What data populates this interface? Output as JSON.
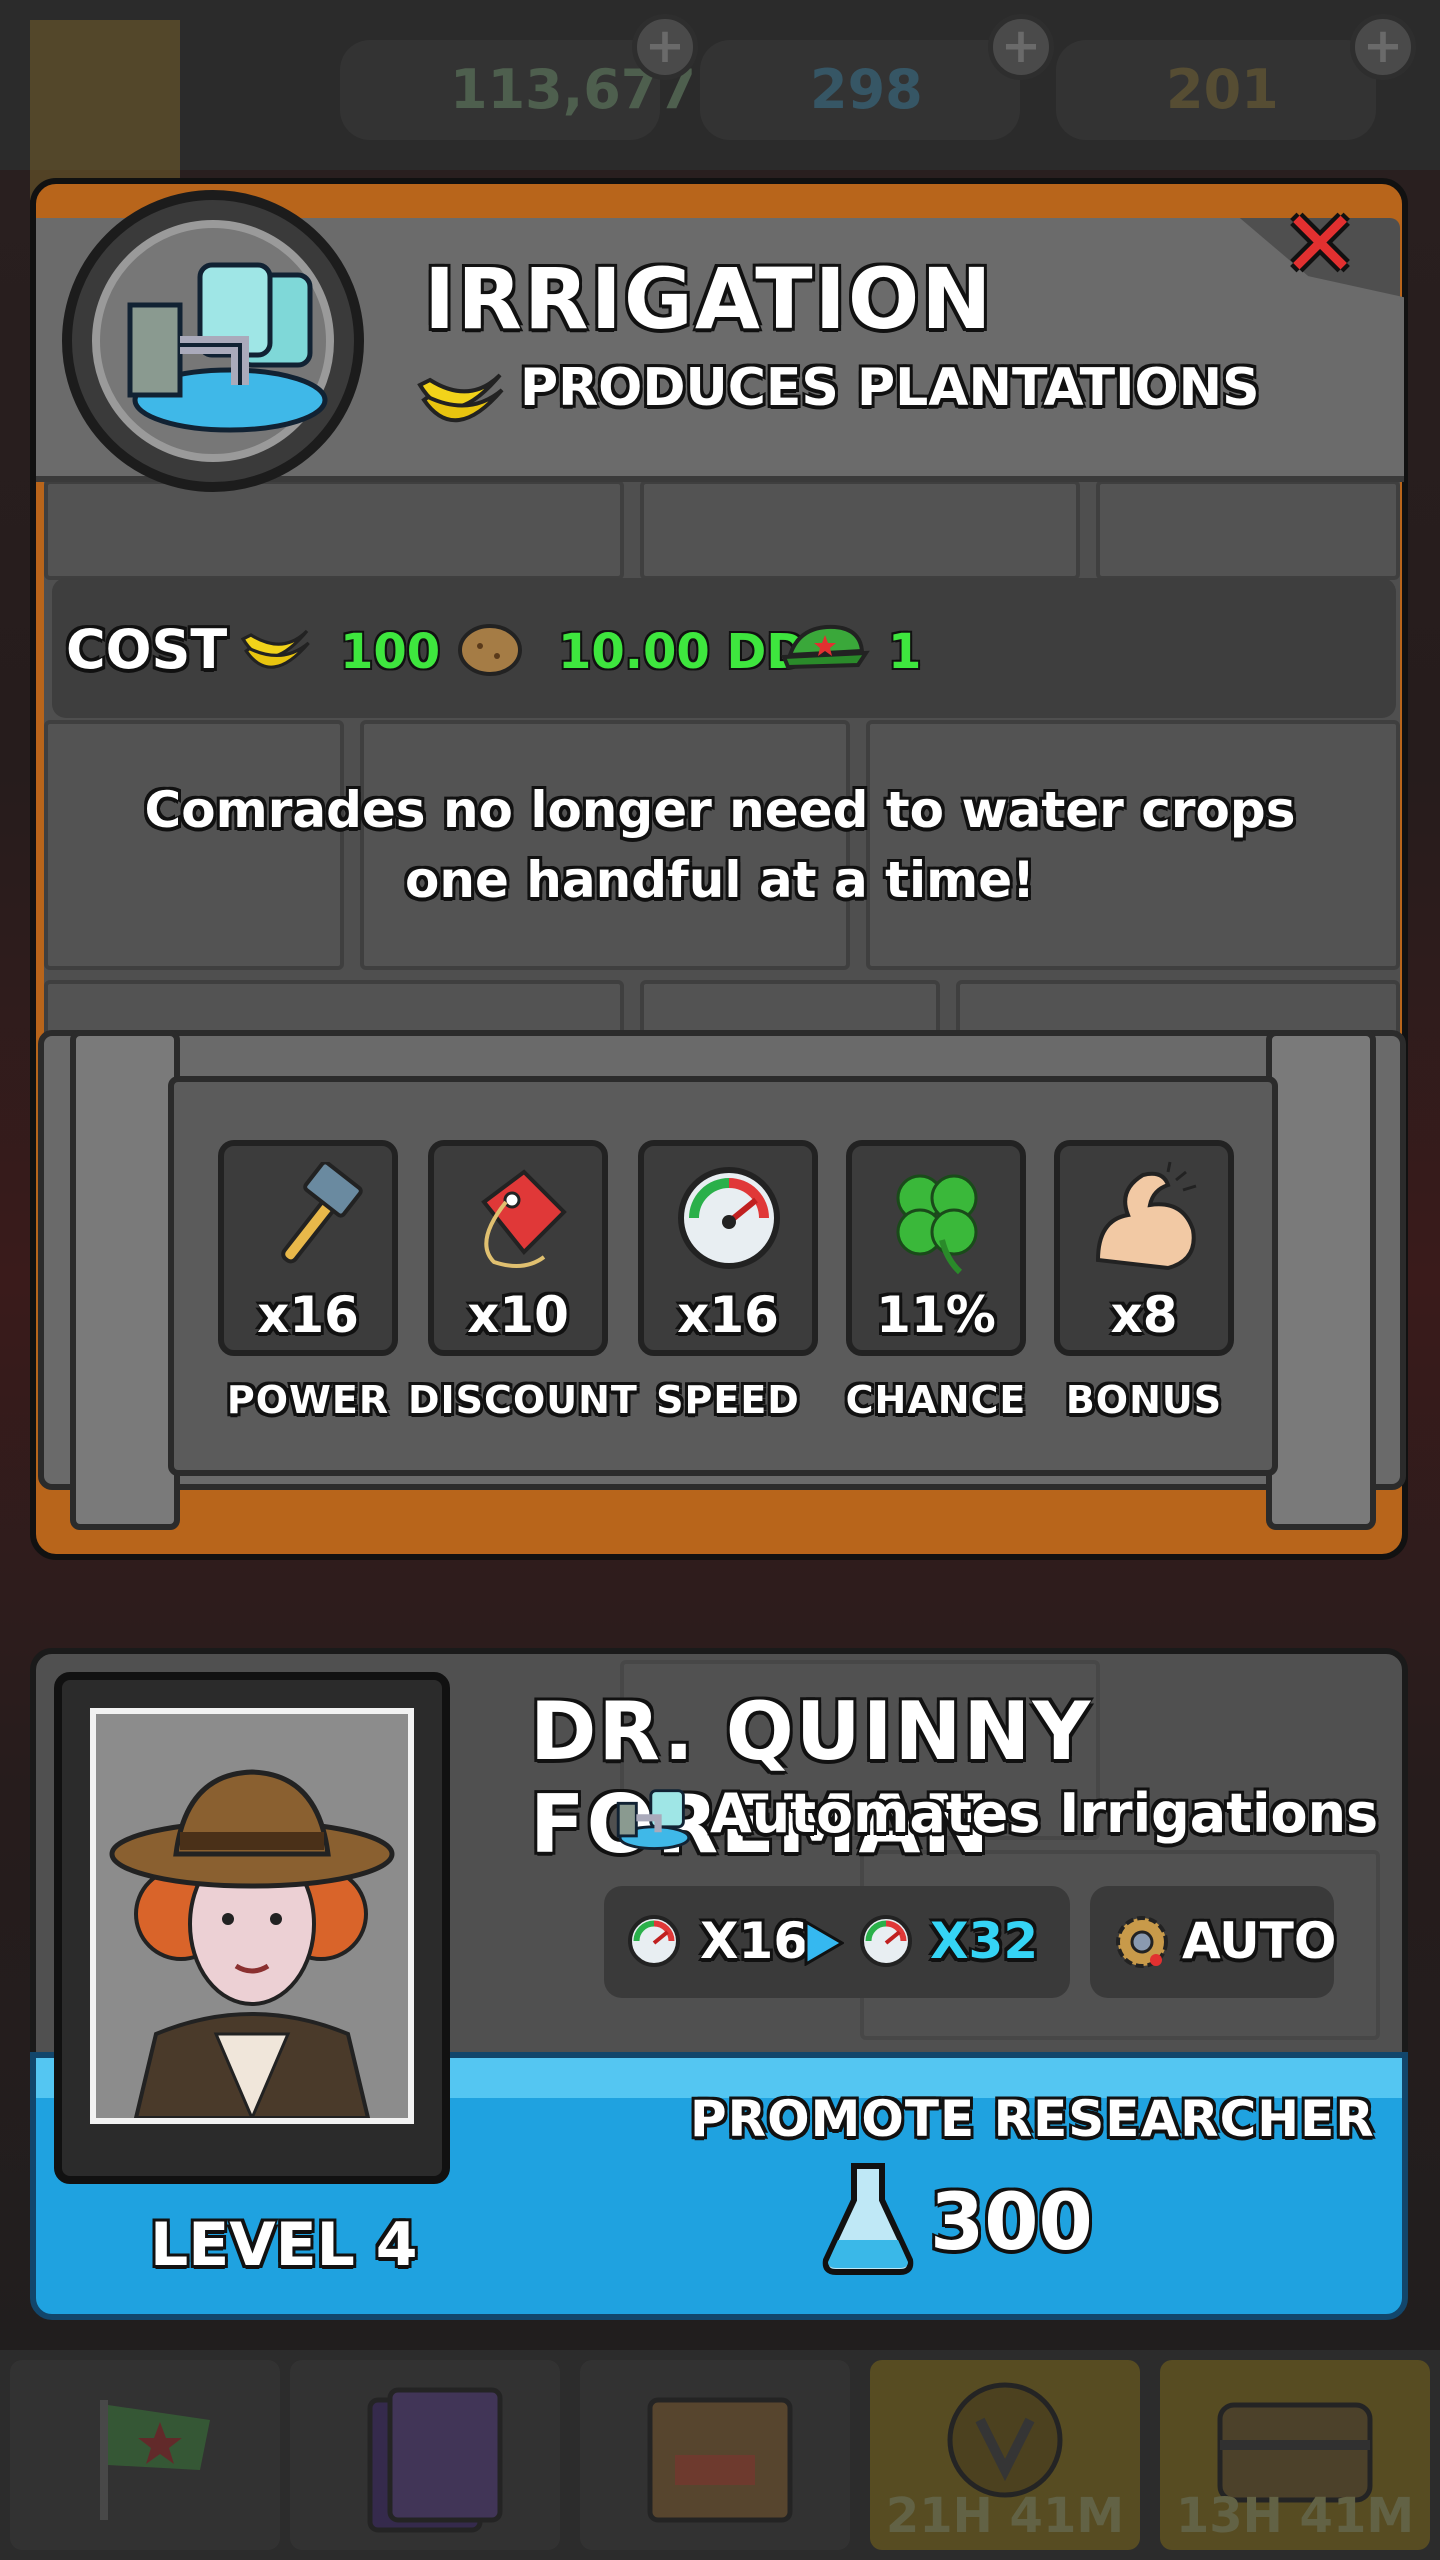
{
  "top_bar": {
    "cash": "113,677",
    "science": "298",
    "gold": "201"
  },
  "upgrade": {
    "title": "IRRIGATION",
    "subtitle": "PRODUCES PLANTATIONS",
    "cost_label": "COST",
    "costs": [
      {
        "icon": "banana-icon",
        "value": "100"
      },
      {
        "icon": "potato-icon",
        "value": "10.00 DD"
      },
      {
        "icon": "comrade-cap-icon",
        "value": "1"
      }
    ],
    "description": "Comrades no longer need to water crops one handful at a time!",
    "stats": [
      {
        "icon": "hammer-icon",
        "value": "x16",
        "label": "POWER"
      },
      {
        "icon": "price-tag-icon",
        "value": "x10",
        "label": "DISCOUNT"
      },
      {
        "icon": "speedometer-icon",
        "value": "x16",
        "label": "SPEED"
      },
      {
        "icon": "clover-icon",
        "value": "11%",
        "label": "CHANCE"
      },
      {
        "icon": "flexed-arm-icon",
        "value": "x8",
        "label": "BONUS"
      }
    ]
  },
  "researcher": {
    "name": "DR. QUINNY FOREMAN",
    "description": "Automates Irrigations",
    "speed_from": "X16",
    "speed_to": "X32",
    "auto_label": "AUTO",
    "level": "LEVEL 4",
    "promote_label": "PROMOTE RESEARCHER",
    "promote_cost": "300"
  },
  "bottom_nav": {
    "timer_1": "21H 41M",
    "timer_2": "13H 41M"
  },
  "colors": {
    "accent_green": "#3ee63e",
    "accent_cyan": "#35d4f5",
    "promote_blue": "#1fa2e0",
    "frame_orange": "#b8651b",
    "close_red": "#e23030"
  }
}
